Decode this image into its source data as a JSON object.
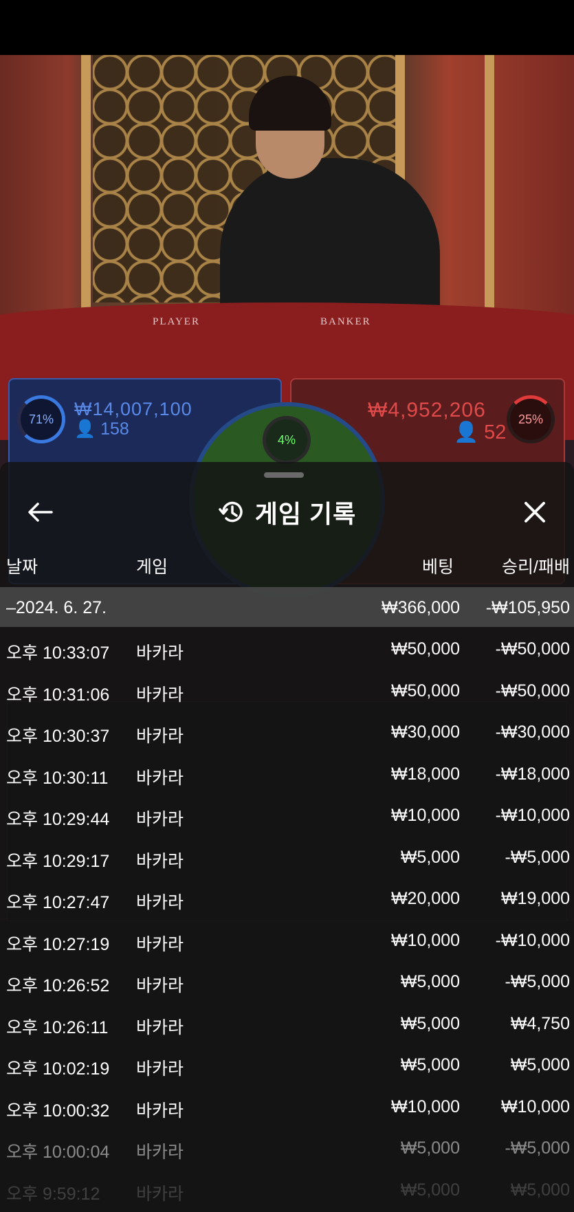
{
  "table_labels": {
    "player": "PLAYER",
    "banker": "BANKER"
  },
  "player_bets": {
    "percent": "71%",
    "total": "₩14,007,100",
    "count": "158"
  },
  "banker_bets": {
    "percent": "25%",
    "total": "₩4,952,206",
    "count": "52"
  },
  "tie_bets": {
    "percent": "4%"
  },
  "history": {
    "title": "게임 기록",
    "columns": {
      "date": "날짜",
      "game": "게임",
      "bet": "베팅",
      "result": "승리/패배"
    },
    "group": {
      "date": "–2024. 6. 27.",
      "bet": "₩366,000",
      "result": "-₩105,950"
    },
    "rows": [
      {
        "time": "오후 10:33:07",
        "game": "바카라",
        "bet": "₩50,000",
        "result": "-₩50,000"
      },
      {
        "time": "오후 10:31:06",
        "game": "바카라",
        "bet": "₩50,000",
        "result": "-₩50,000"
      },
      {
        "time": "오후 10:30:37",
        "game": "바카라",
        "bet": "₩30,000",
        "result": "-₩30,000"
      },
      {
        "time": "오후 10:30:11",
        "game": "바카라",
        "bet": "₩18,000",
        "result": "-₩18,000"
      },
      {
        "time": "오후 10:29:44",
        "game": "바카라",
        "bet": "₩10,000",
        "result": "-₩10,000"
      },
      {
        "time": "오후 10:29:17",
        "game": "바카라",
        "bet": "₩5,000",
        "result": "-₩5,000"
      },
      {
        "time": "오후 10:27:47",
        "game": "바카라",
        "bet": "₩20,000",
        "result": "₩19,000"
      },
      {
        "time": "오후 10:27:19",
        "game": "바카라",
        "bet": "₩10,000",
        "result": "-₩10,000"
      },
      {
        "time": "오후 10:26:52",
        "game": "바카라",
        "bet": "₩5,000",
        "result": "-₩5,000"
      },
      {
        "time": "오후 10:26:11",
        "game": "바카라",
        "bet": "₩5,000",
        "result": "₩4,750"
      },
      {
        "time": "오후 10:02:19",
        "game": "바카라",
        "bet": "₩5,000",
        "result": "₩5,000"
      },
      {
        "time": "오후 10:00:32",
        "game": "바카라",
        "bet": "₩10,000",
        "result": "₩10,000"
      },
      {
        "time": "오후 10:00:04",
        "game": "바카라",
        "bet": "₩5,000",
        "result": "-₩5,000"
      },
      {
        "time": "오후 9:59:12",
        "game": "바카라",
        "bet": "₩5,000",
        "result": "₩5,000"
      }
    ]
  }
}
